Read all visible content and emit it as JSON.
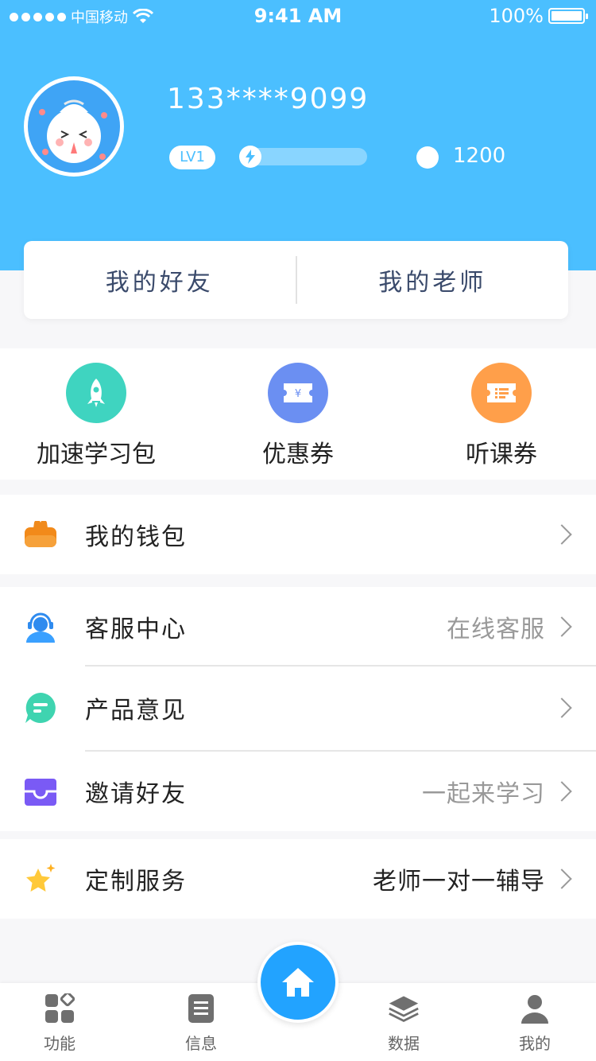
{
  "status_bar": {
    "carrier": "中国移动",
    "time": "9:41 AM",
    "battery": "100%"
  },
  "profile": {
    "phone": "133****9099",
    "level": "LV1",
    "progress_fraction": 0.1,
    "coins": "1200"
  },
  "friends": {
    "friends_label": "我的好友",
    "teachers_label": "我的老师"
  },
  "quick_actions": [
    {
      "label": "加速学习包",
      "icon": "rocket-icon",
      "color": "#3fd4c0"
    },
    {
      "label": "优惠券",
      "icon": "coupon-icon",
      "color": "#6b8ff2"
    },
    {
      "label": "听课券",
      "icon": "ticket-icon",
      "color": "#ff9f4a"
    }
  ],
  "menu": {
    "wallet": {
      "label": "我的钱包",
      "value": ""
    },
    "service": {
      "label": "客服中心",
      "value": "在线客服"
    },
    "feedback": {
      "label": "产品意见",
      "value": ""
    },
    "invite": {
      "label": "邀请好友",
      "value": "一起来学习"
    },
    "custom": {
      "label": "定制服务",
      "value": "老师一对一辅导"
    }
  },
  "tabs": [
    {
      "label": "功能",
      "icon": "grid-icon"
    },
    {
      "label": "信息",
      "icon": "document-icon"
    },
    {
      "label": "",
      "icon": "home-icon"
    },
    {
      "label": "数据",
      "icon": "layers-icon"
    },
    {
      "label": "我的",
      "icon": "person-icon"
    }
  ],
  "colors": {
    "header": "#4bbfff",
    "accent": "#22a3ff"
  }
}
